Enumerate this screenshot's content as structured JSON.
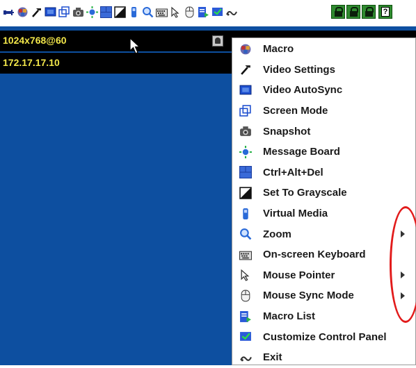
{
  "toolbar": {
    "icons": [
      "pin-icon",
      "macro-icon",
      "video-settings-icon",
      "video-autosync-icon",
      "screen-mode-icon",
      "snapshot-icon",
      "message-board-icon",
      "ctrl-alt-del-icon",
      "grayscale-icon",
      "virtual-media-icon",
      "zoom-icon",
      "keyboard-icon",
      "mouse-pointer-icon",
      "mouse-sync-icon",
      "macro-list-icon",
      "customize-icon",
      "exit-icon"
    ],
    "lock_icons": [
      "num-lock-icon",
      "caps-lock-icon",
      "scroll-lock-icon"
    ],
    "help_label": "?"
  },
  "screen": {
    "resolution": "1024x768@60",
    "ip_address": "172.17.17.10"
  },
  "menu": {
    "items": [
      {
        "label": "Macro",
        "icon": "macro-icon",
        "submenu": false
      },
      {
        "label": "Video Settings",
        "icon": "video-settings-icon",
        "submenu": false
      },
      {
        "label": "Video AutoSync",
        "icon": "video-autosync-icon",
        "submenu": false
      },
      {
        "label": "Screen Mode",
        "icon": "screen-mode-icon",
        "submenu": false
      },
      {
        "label": "Snapshot",
        "icon": "snapshot-icon",
        "submenu": false
      },
      {
        "label": "Message Board",
        "icon": "message-board-icon",
        "submenu": false
      },
      {
        "label": "Ctrl+Alt+Del",
        "icon": "ctrl-alt-del-icon",
        "submenu": false
      },
      {
        "label": "Set To Grayscale",
        "icon": "grayscale-icon",
        "submenu": false
      },
      {
        "label": "Virtual Media",
        "icon": "virtual-media-icon",
        "submenu": false
      },
      {
        "label": "Zoom",
        "icon": "zoom-icon",
        "submenu": true
      },
      {
        "label": "On-screen Keyboard",
        "icon": "keyboard-icon",
        "submenu": false
      },
      {
        "label": "Mouse Pointer",
        "icon": "mouse-pointer-icon",
        "submenu": true
      },
      {
        "label": "Mouse Sync Mode",
        "icon": "mouse-sync-icon",
        "submenu": true
      },
      {
        "label": "Macro List",
        "icon": "macro-list-icon",
        "submenu": false
      },
      {
        "label": "Customize Control Panel",
        "icon": "customize-icon",
        "submenu": false
      },
      {
        "label": "Exit",
        "icon": "exit-icon",
        "submenu": false
      }
    ]
  },
  "colors": {
    "screen_background": "#0d4fa0",
    "info_text": "#f2e64a",
    "highlight": "#e21b1b"
  }
}
